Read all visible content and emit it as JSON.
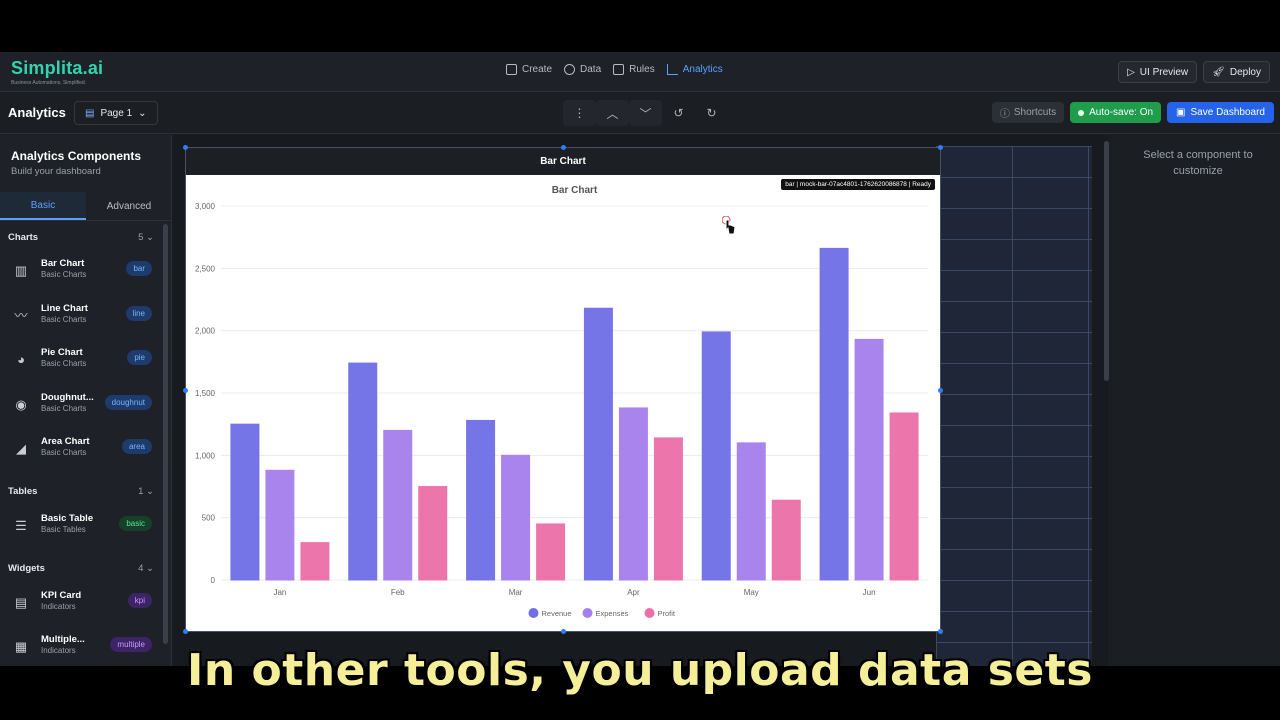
{
  "app": {
    "logo": "Simplita.ai",
    "tagline": "Business Automations, Simplified."
  },
  "nav": [
    {
      "label": "Create",
      "icon": "edit-icon"
    },
    {
      "label": "Data",
      "icon": "database-icon"
    },
    {
      "label": "Rules",
      "icon": "rules-icon"
    },
    {
      "label": "Analytics",
      "icon": "analytics-icon",
      "active": true
    }
  ],
  "top_actions": {
    "preview": "UI Preview",
    "deploy": "Deploy"
  },
  "toolbar": {
    "title": "Analytics",
    "page": "Page 1",
    "shortcuts": "Shortcuts",
    "autosave": "Auto-save: On",
    "save": "Save Dashboard"
  },
  "sidebar": {
    "title": "Analytics Components",
    "subtitle": "Build your dashboard",
    "tabs": [
      "Basic",
      "Advanced"
    ],
    "sections": [
      {
        "name": "Charts",
        "count": "5"
      },
      {
        "name": "Tables",
        "count": "1"
      },
      {
        "name": "Widgets",
        "count": "4"
      }
    ],
    "items": [
      {
        "name": "Bar Chart",
        "category": "Basic Charts",
        "badge": "bar"
      },
      {
        "name": "Line Chart",
        "category": "Basic Charts",
        "badge": "line"
      },
      {
        "name": "Pie Chart",
        "category": "Basic Charts",
        "badge": "pie"
      },
      {
        "name": "Doughnut...",
        "category": "Basic Charts",
        "badge": "doughnut"
      },
      {
        "name": "Area Chart",
        "category": "Basic Charts",
        "badge": "area"
      },
      {
        "name": "Basic Table",
        "category": "Basic Tables",
        "badge": "basic"
      },
      {
        "name": "KPI Card",
        "category": "Indicators",
        "badge": "kpi"
      },
      {
        "name": "Multiple...",
        "category": "Indicators",
        "badge": "multiple"
      }
    ]
  },
  "widget": {
    "header": "Bar Chart",
    "tag": "bar | mock-bar-07ac4801-1762620086878 | Ready"
  },
  "right_panel": {
    "text": "Select a component to customize"
  },
  "caption": "In other tools, you upload data sets",
  "chart_data": {
    "type": "bar",
    "title": "Bar Chart",
    "categories": [
      "Jan",
      "Feb",
      "Mar",
      "Apr",
      "May",
      "Jun"
    ],
    "series": [
      {
        "name": "Revenue",
        "color": "#6f6ee6",
        "values": [
          1250,
          1740,
          1280,
          2180,
          1990,
          2660
        ]
      },
      {
        "name": "Expenses",
        "color": "#a47eec",
        "values": [
          880,
          1200,
          1000,
          1380,
          1100,
          1930
        ]
      },
      {
        "name": "Profit",
        "color": "#ec6fa8",
        "values": [
          300,
          750,
          450,
          1140,
          640,
          1340
        ]
      }
    ],
    "yticks": [
      "0",
      "500",
      "1,000",
      "1,500",
      "2,000",
      "2,500",
      "3,000"
    ],
    "ylim": [
      0,
      3000
    ],
    "legend": "bottom",
    "grid": true
  }
}
